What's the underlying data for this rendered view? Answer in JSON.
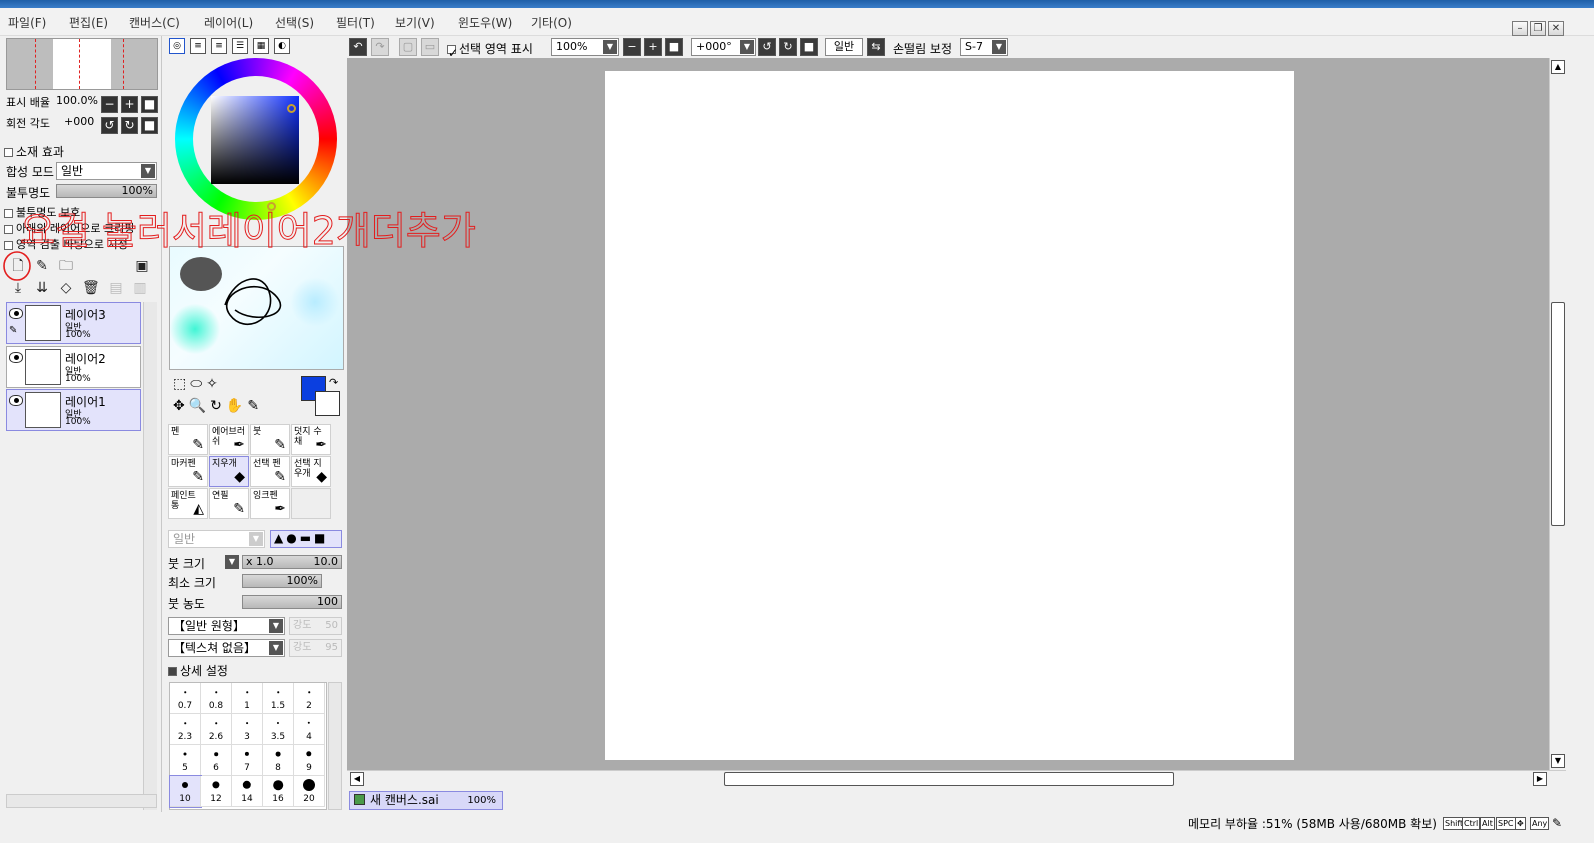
{
  "menu": [
    "파일(F)",
    "편집(E)",
    "캔버스(C)",
    "레이어(L)",
    "선택(S)",
    "필터(T)",
    "보기(V)",
    "윈도우(W)",
    "기타(O)"
  ],
  "navigator": {
    "zoom_label": "표시 배율",
    "zoom_value": "100.0%",
    "rotate_label": "회전 각도",
    "rotate_value": "+000"
  },
  "layer_props": {
    "texture_label": "소재 효과",
    "blend_label": "합성 모드",
    "blend_value": "일반",
    "opacity_label": "불투명도",
    "opacity_value": "100%",
    "protect_opacity": "불투명도 보호",
    "clip_below": "아래의 레이어으로 크리핑",
    "selection_source": "영역 검출 바탕으로 지정"
  },
  "layers": [
    {
      "name": "레이어3",
      "mode": "일반",
      "opacity": "100%",
      "selected": true
    },
    {
      "name": "레이어2",
      "mode": "일반",
      "opacity": "100%",
      "selected": false
    },
    {
      "name": "레이어1",
      "mode": "일반",
      "opacity": "100%",
      "selected": true
    }
  ],
  "tools": {
    "cells": [
      {
        "label": "펜",
        "icon": "✎",
        "selected": false
      },
      {
        "label": "에어브러쉬",
        "icon": "✒",
        "selected": false
      },
      {
        "label": "붓",
        "icon": "✎",
        "selected": false
      },
      {
        "label": "덧지 수채",
        "icon": "✒",
        "selected": false
      },
      {
        "label": "마커펜",
        "icon": "✎",
        "selected": false
      },
      {
        "label": "지우개",
        "icon": "◆",
        "selected": true
      },
      {
        "label": "선택 펜",
        "icon": "✎",
        "selected": false
      },
      {
        "label": "선택 지우개",
        "icon": "◆",
        "selected": false
      },
      {
        "label": "페인트 통",
        "icon": "◭",
        "selected": false
      },
      {
        "label": "연필",
        "icon": "✎",
        "selected": false
      },
      {
        "label": "잉크펜",
        "icon": "✒",
        "selected": false
      }
    ],
    "blend_value": "일반",
    "brush_size_label": "붓 크기",
    "brush_size_mult": "x 1.0",
    "brush_size_value": "10.0",
    "min_size_label": "최소 크기",
    "min_size_value": "100%",
    "density_label": "붓 농도",
    "density_value": "100",
    "shape_value": "【일반 원형】",
    "shape_strength_label": "강도",
    "shape_strength_value": "50",
    "texture_value": "【텍스쳐 없음】",
    "texture_strength_label": "강도",
    "texture_strength_value": "95",
    "advanced_label": "상세 설정",
    "brush_sizes": [
      "0.7",
      "0.8",
      "1",
      "1.5",
      "2",
      "2.3",
      "2.6",
      "3",
      "3.5",
      "4",
      "5",
      "6",
      "7",
      "8",
      "9",
      "10",
      "12",
      "14",
      "16",
      "20"
    ],
    "selected_size": "10"
  },
  "colors": {
    "foreground": "#0b3fe0",
    "background": "#ffffff",
    "accent": "#8a8ae0"
  },
  "toolbar": {
    "show_selection": "선택 영역 표시",
    "zoom": "100%",
    "rotation": "+000°",
    "mode": "일반",
    "stabilizer_label": "손떨림 보정",
    "stabilizer_value": "S-7"
  },
  "document": {
    "name": "새 캔버스.sai",
    "zoom": "100%"
  },
  "status": {
    "memory": "메모리 부하율 :51% (58MB 사용/680MB 확보)",
    "keys": [
      "Shift",
      "Ctrl",
      "Alt",
      "SPC",
      "Any"
    ]
  },
  "annotation": {
    "text": "요걸 눌러서레이어2개더추가"
  }
}
